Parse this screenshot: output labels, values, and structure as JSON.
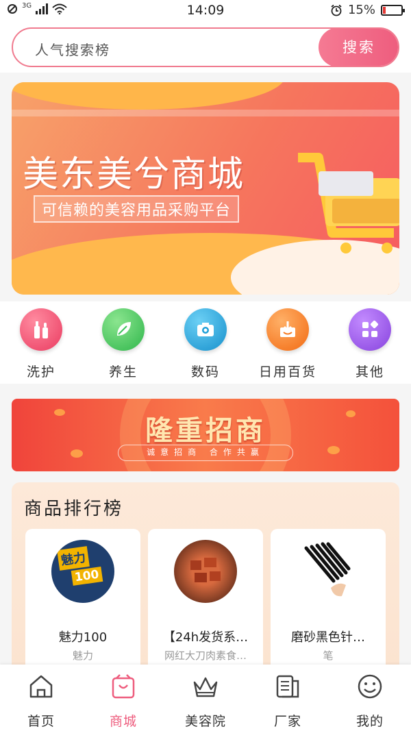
{
  "status_bar": {
    "network": "3G",
    "time": "14:09",
    "battery_percent_text": "15%",
    "battery_level": 0.15
  },
  "search": {
    "placeholder": "人气搜索榜",
    "button_label": "搜索"
  },
  "banner": {
    "title": "美东美兮商城",
    "subtitle": "可信赖的美容用品采购平台"
  },
  "categories": [
    {
      "label": "洗护",
      "icon": "cosmetics-icon",
      "color": "#ee4c6b"
    },
    {
      "label": "养生",
      "icon": "leaf-icon",
      "color": "#3cc45a"
    },
    {
      "label": "数码",
      "icon": "camera-icon",
      "color": "#1e9fd8"
    },
    {
      "label": "日用百货",
      "icon": "inbox-icon",
      "color": "#f7791f"
    },
    {
      "label": "其他",
      "icon": "grid-icon",
      "color": "#9a55e6"
    }
  ],
  "promo": {
    "title": "隆重招商",
    "subtitle": "诚意招商 合作共赢"
  },
  "ranking": {
    "heading": "商品排行榜",
    "items": [
      {
        "name": "魅力100",
        "desc": "魅力",
        "thumb_text": "魅力",
        "thumb_sub": "100"
      },
      {
        "name": "【24h发货系…",
        "desc": "网红大刀肉素食…"
      },
      {
        "name": "磨砂黑色针…",
        "desc": "笔"
      }
    ]
  },
  "tabbar": {
    "active": "商城",
    "items": [
      {
        "label": "首页",
        "icon": "home-icon"
      },
      {
        "label": "商城",
        "icon": "shopping-bag-icon"
      },
      {
        "label": "美容院",
        "icon": "crown-icon"
      },
      {
        "label": "厂家",
        "icon": "document-icon"
      },
      {
        "label": "我的",
        "icon": "smiley-icon"
      }
    ]
  },
  "colors": {
    "accent": "#ee5d7e",
    "promo_red": "#f0443b",
    "banner_orange": "#f6765d"
  }
}
